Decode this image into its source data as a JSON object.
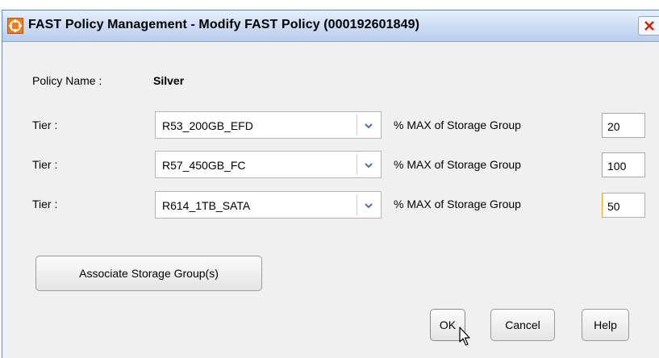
{
  "window": {
    "title": "FAST Policy Management - Modify FAST Policy (000192601849)",
    "icon": "app-logo-icon",
    "close_icon": "close-icon"
  },
  "policy": {
    "name_label": "Policy Name :",
    "name_value": "Silver"
  },
  "tiers": [
    {
      "label": "Tier :",
      "selected": "R53_200GB_EFD",
      "max_label": "% MAX of Storage Group",
      "max_value": "20"
    },
    {
      "label": "Tier :",
      "selected": "R57_450GB_FC",
      "max_label": "% MAX of Storage Group",
      "max_value": "100"
    },
    {
      "label": "Tier :",
      "selected": "R614_1TB_SATA",
      "max_label": "% MAX of Storage Group",
      "max_value": "50"
    }
  ],
  "buttons": {
    "associate": "Associate Storage Group(s)",
    "ok": "OK",
    "cancel": "Cancel",
    "help": "Help"
  },
  "colors": {
    "accent_icon": "#f07a14",
    "focused_field_border": "#f2a62a",
    "close_icon": "#cc2200"
  }
}
